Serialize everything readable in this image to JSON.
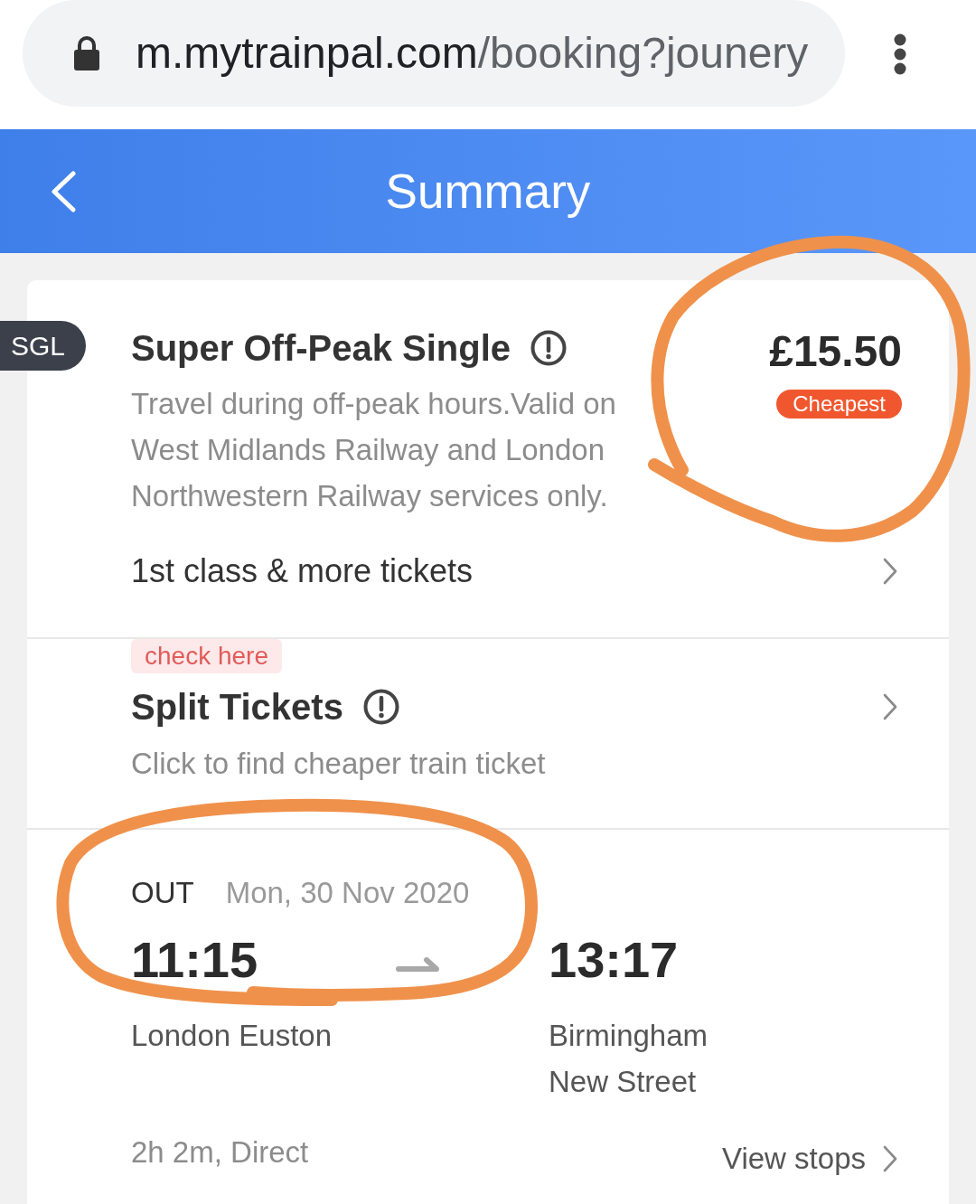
{
  "browser": {
    "secure": true,
    "url": {
      "host": "m.mytrainpal.com",
      "path": "/booking?jounery"
    }
  },
  "header": {
    "title": "Summary"
  },
  "fare": {
    "type_badge": "SGL",
    "name": "Super Off-Peak Single",
    "description": "Travel during off-peak hours.Valid on West Midlands Railway and London Northwestern Railway services only.",
    "price": "£15.50",
    "price_badge": "Cheapest",
    "more_tickets": "1st class & more tickets"
  },
  "split_tickets": {
    "tag": "check here",
    "title": "Split Tickets",
    "subtitle": "Click to find cheaper train ticket"
  },
  "journey": {
    "direction": "OUT",
    "date": "Mon, 30 Nov 2020",
    "departure": {
      "time": "11:15",
      "station": "London Euston"
    },
    "arrival": {
      "time": "13:17",
      "station": "Birmingham New Street"
    },
    "duration": "2h 2m, Direct",
    "view_stops": "View stops"
  },
  "annotations": [
    {
      "kind": "freehand-circle"
    },
    {
      "kind": "freehand-circle"
    }
  ]
}
